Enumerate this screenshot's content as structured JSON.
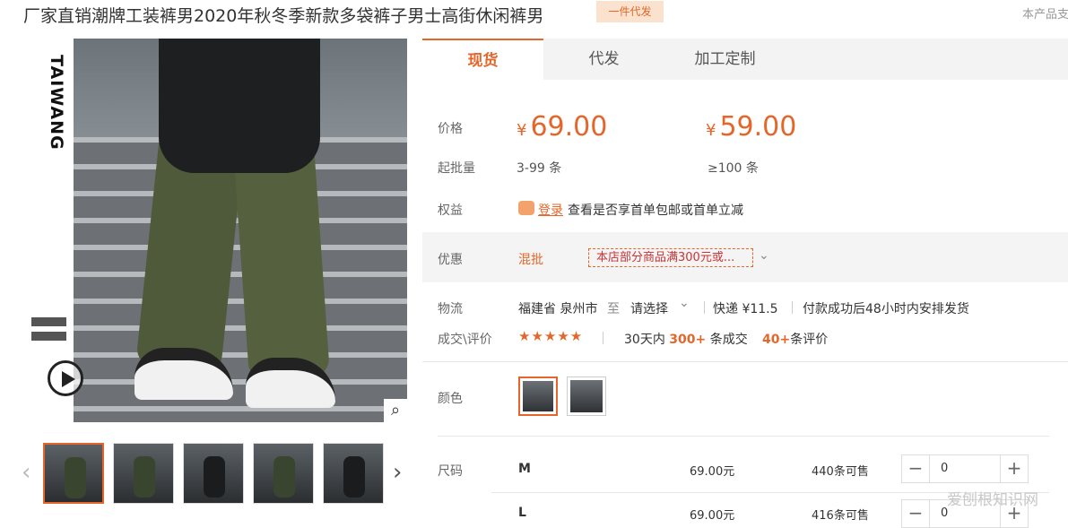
{
  "header": {
    "title": "厂家直销潮牌工装裤男2020年秋冬季新款多袋裤子男士高街休闲裤男",
    "badge": "一件代发",
    "top_right": "本产品支"
  },
  "gallery": {
    "brand_text": "TAIWANG",
    "zoom_icon": "magnifier-icon",
    "play_icon": "play-icon"
  },
  "tabs": [
    {
      "label": "现货"
    },
    {
      "label": "代发"
    },
    {
      "label": "加工定制"
    }
  ],
  "price": {
    "label": "价格",
    "currency": "¥",
    "tier1": "69.00",
    "tier2": "59.00",
    "moq_label": "起批量",
    "moq1": "3-99 条",
    "moq2": "≥100 条"
  },
  "benefits": {
    "label": "权益",
    "login": "登录",
    "text": "查看是否享首单包邮或首单立减"
  },
  "discount": {
    "label": "优惠",
    "mix": "混批",
    "coupon": "本店部分商品满300元或..."
  },
  "shipping": {
    "label": "物流",
    "origin": "福建省 泉州市",
    "to": "至",
    "select": "请选择",
    "express": "快递 ¥11.5",
    "dispatch": "付款成功后48小时内安排发货"
  },
  "reviews": {
    "label": "成交\\评价",
    "prefix30": "30天内",
    "sold": "300+",
    "sold_suffix": "条成交",
    "reviews": "40+",
    "reviews_suffix": "条评价",
    "rating_stars": 4.5
  },
  "color": {
    "label": "颜色"
  },
  "sizes": {
    "label": "尺码",
    "rows": [
      {
        "size": "M",
        "price": "69.00元",
        "stock": "440条可售",
        "qty": "0"
      },
      {
        "size": "L",
        "price": "69.00元",
        "stock": "416条可售",
        "qty": "0"
      }
    ]
  },
  "watermark": "爱刨根知识网",
  "colors": {
    "accent": "#e4662a",
    "badge_bg": "#fbe2cf"
  }
}
